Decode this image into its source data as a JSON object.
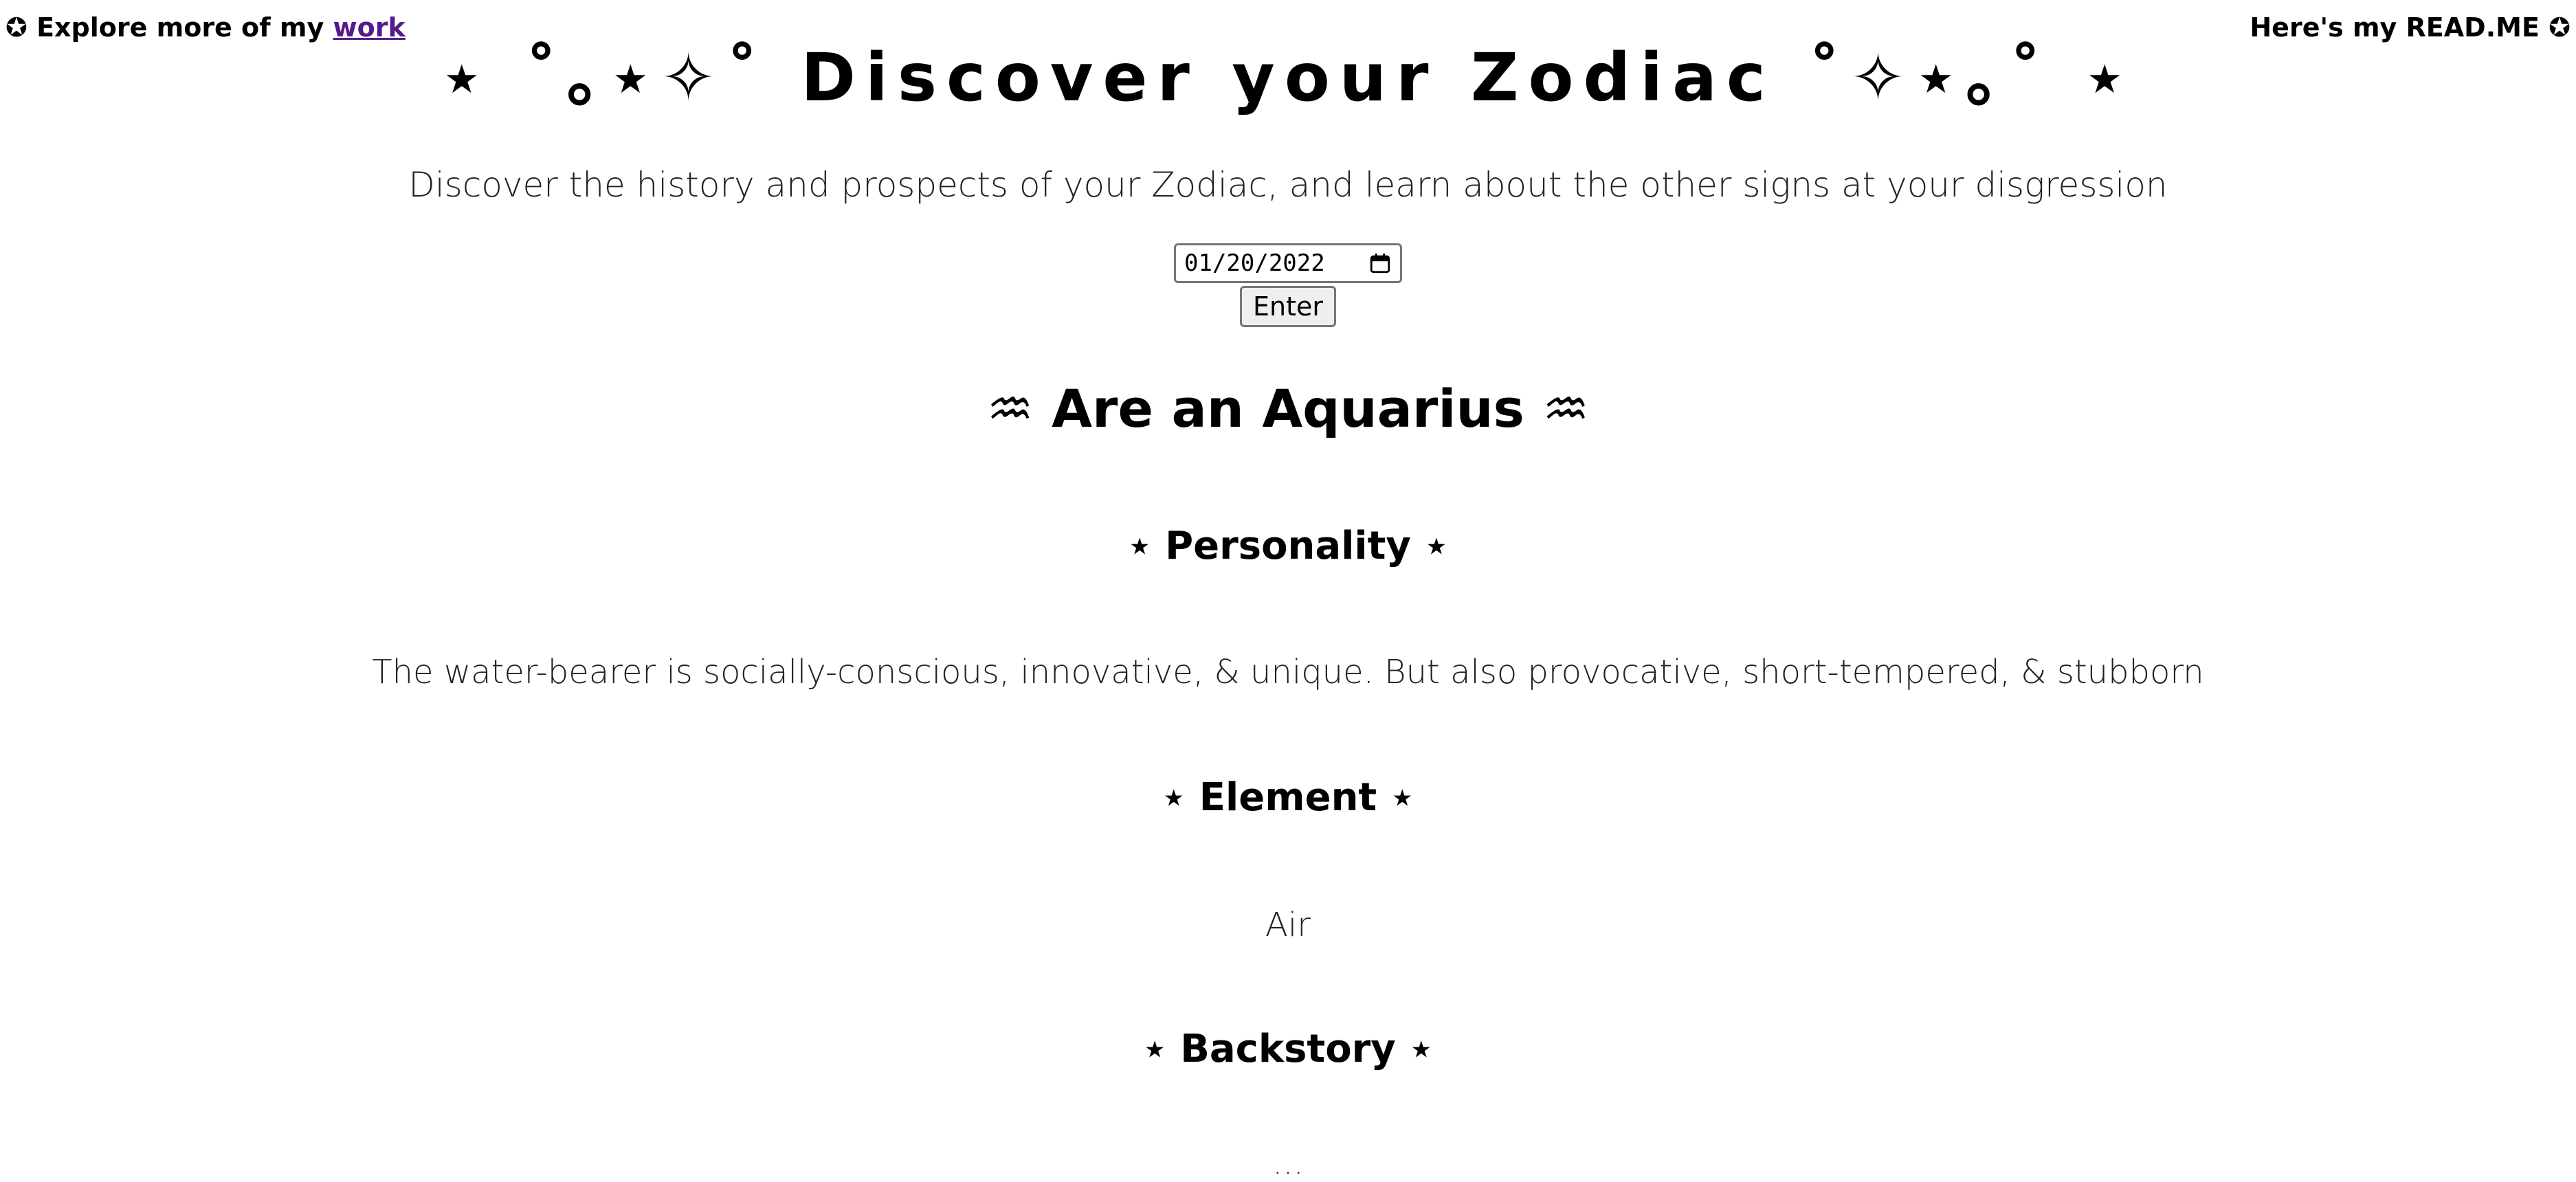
{
  "nav": {
    "left_prefix": "✪ Explore more of my ",
    "left_link": "work",
    "right_label": "Here's my READ.ME ✪"
  },
  "header": {
    "title": "⋆ ˚｡⋆✧˚ Discover your Zodiac ˚✧⋆｡˚ ⋆",
    "tagline": "Discover the history and prospects of your Zodiac, and learn about the other signs at your disgression"
  },
  "form": {
    "date_value": "01/20/2022",
    "enter_label": "Enter"
  },
  "result": {
    "sign_heading": "♒ Are an Aquarius ♒",
    "personality_heading": "⋆ Personality ⋆",
    "personality_text": "The water-bearer is socially-conscious, innovative, & unique. But also provocative, short-tempered, & stubborn",
    "element_heading": "⋆ Element ⋆",
    "element_text": "Air",
    "backstory_heading": "⋆ Backstory ⋆",
    "backstory_text": "..."
  },
  "icons": {
    "calendar": "calendar-icon"
  },
  "colors": {
    "link_visited": "#551a8b",
    "text": "#000000",
    "background": "#ffffff"
  }
}
